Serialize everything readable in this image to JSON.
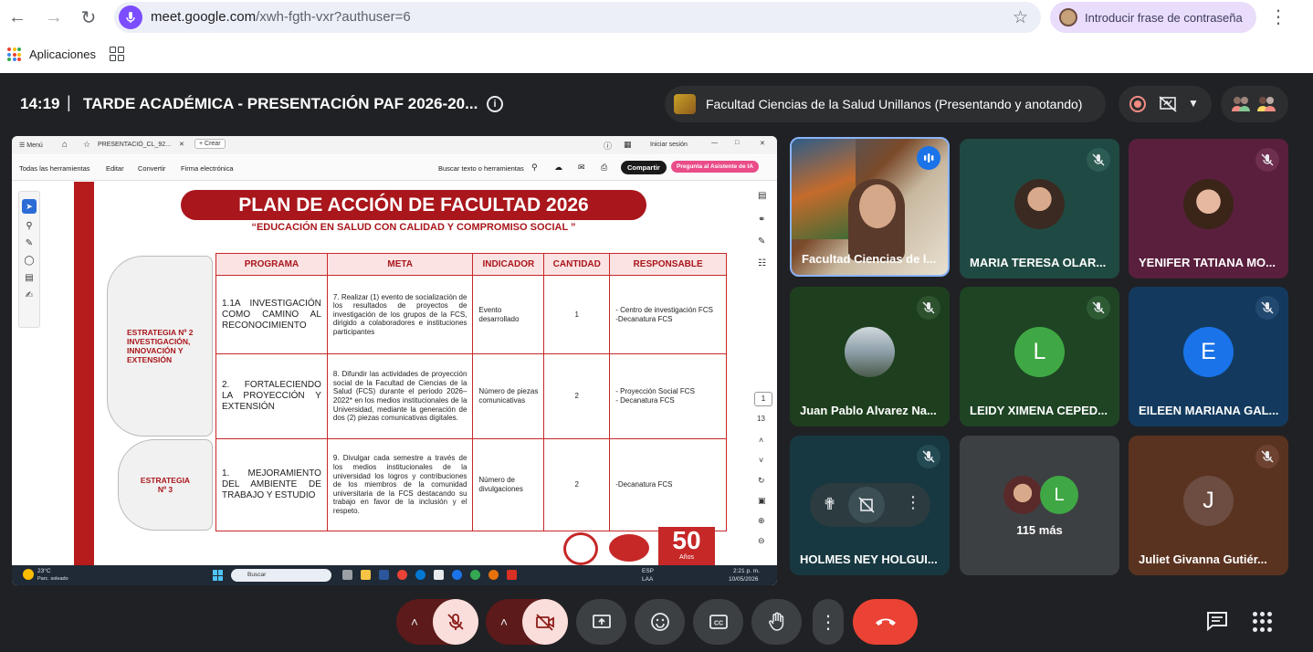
{
  "browser": {
    "url_host": "meet.google.com",
    "url_path": "/xwh-fgth-vxr?authuser=6",
    "passphrase_label": "Introducir frase de contraseña",
    "bookmark_apps_label": "Aplicaciones"
  },
  "meet": {
    "time": "14:19",
    "separator": "|",
    "title": "TARDE ACADÉMICA - PRESENTACIÓN PAF 2026-20...",
    "presenter_label": "Facultad Ciencias de la Salud Unillanos (Presentando y anotando)"
  },
  "pdf": {
    "tab_menu": "Menú",
    "tab_title": "PRESENTACIÓ_CL_92...",
    "tab_create": "+ Crear",
    "signin": "Iniciar sesión",
    "tools": [
      "Todas las herramientas",
      "Editar",
      "Convertir",
      "Firma electrónica"
    ],
    "search": "Buscar texto o herramientas",
    "share_btn": "Compartir",
    "ai_btn": "Pregunta al Asistente de IA",
    "page_current": "1",
    "page_total": "13"
  },
  "slide": {
    "title": "PLAN DE ACCIÓN DE FACULTAD 2026",
    "subtitle": "“EDUCACIÓN EN SALUD CON CALIDAD Y COMPROMISO SOCIAL ”",
    "strategy2": "ESTRATEGIA Nº 2 INVESTIGACIÓN, INNOVACIÓN Y EXTENSIÓN",
    "strategy3": "ESTRATEGIA Nº 3",
    "columns": [
      "PROGRAMA",
      "META",
      "INDICADOR",
      "CANTIDAD",
      "RESPONSABLE"
    ],
    "rows": [
      {
        "programa": "1.1A INVESTIGACIÓN COMO CAMINO AL RECONOCIMIENTO",
        "meta": "7. Realizar (1) evento de socialización de los resultados de proyectos de investigación de los grupos de la FCS, dirigido a colaboradores e instituciones participantes",
        "indicador": "Evento desarrollado",
        "cantidad": "1",
        "responsable1": "- Centro de investigación FCS",
        "responsable2": "-Decanatura FCS"
      },
      {
        "programa": "2. FORTALECIENDO LA PROYECCIÓN Y EXTENSIÓN",
        "meta": "8. Difundir las actividades de proyección social de la Facultad de Ciencias de la Salud (FCS) durante el periodo 2026–2022* en los medios institucionales de la Universidad, mediante la generación de dos (2) piezas comunicativas digitales.",
        "indicador": "Número de piezas comunicativas",
        "cantidad": "2",
        "responsable1": "- Proyección Social FCS",
        "responsable2": "- Decanatura FCS"
      },
      {
        "programa": "1. MEJORAMIENTO DEL AMBIENTE DE TRABAJO Y ESTUDIO",
        "meta": "9. Divulgar cada semestre a través de los medios institucionales de la universidad los logros y contribuciones de los miembros de la comunidad universitaria de la FCS destacando su trabajo en favor de la inclusión y el respeto.",
        "indicador": "Número de divulgaciones",
        "cantidad": "2",
        "responsable1": "-Decanatura FCS",
        "responsable2": ""
      }
    ],
    "logo_50": "50",
    "logo_50_sub": "Años"
  },
  "taskbar": {
    "weather_temp": "23°C",
    "weather_desc": "Parc. soleado",
    "search": "Buscar",
    "lang1": "ESP",
    "lang2": "LAA",
    "clock_time": "2:21 p. m.",
    "clock_date": "10/05/2026"
  },
  "participants": [
    {
      "name": "Facultad Ciencias de l...",
      "type": "video"
    },
    {
      "name": "MARIA TERESA OLAR...",
      "type": "photo"
    },
    {
      "name": "YENIFER TATIANA MO...",
      "type": "photo"
    },
    {
      "name": "Juan Pablo Alvarez Na...",
      "type": "photo"
    },
    {
      "name": "LEIDY XIMENA CEPED...",
      "initial": "L"
    },
    {
      "name": "EILEEN MARIANA GAL...",
      "initial": "E"
    },
    {
      "name": "HOLMES NEY HOLGUI...",
      "type": "hover"
    },
    {
      "name": "115 más",
      "initial": "L",
      "type": "more"
    },
    {
      "name": "Juliet Givanna Gutiér...",
      "initial": "J"
    }
  ],
  "colors": {
    "meet_bg": "#202124",
    "end_call": "#ea4335",
    "muted_ctrl": "#f9dedc",
    "slide_red": "#a9161b"
  }
}
